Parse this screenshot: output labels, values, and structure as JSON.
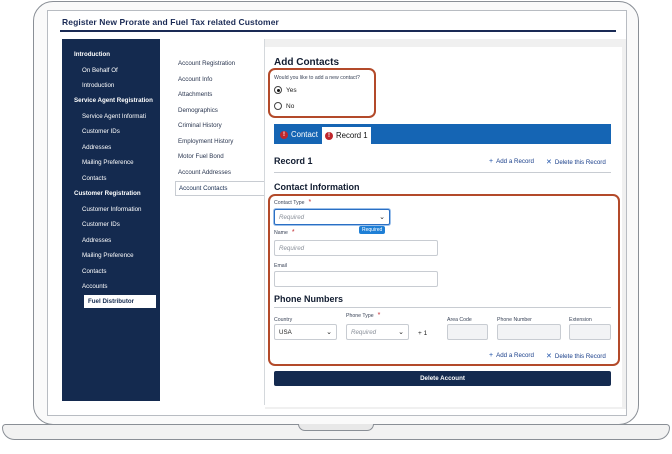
{
  "app": {
    "title": "Register New Prorate and Fuel Tax related Customer"
  },
  "leftnav": {
    "items": [
      {
        "label": "Introduction",
        "head": true
      },
      {
        "label": "On Behalf Of",
        "head": false
      },
      {
        "label": "Introduction",
        "head": false
      },
      {
        "label": "Service Agent Registration",
        "head": true
      },
      {
        "label": "Service Agent Informati",
        "head": false
      },
      {
        "label": "Customer IDs",
        "head": false
      },
      {
        "label": "Addresses",
        "head": false
      },
      {
        "label": "Mailing Preference",
        "head": false
      },
      {
        "label": "Contacts",
        "head": false
      },
      {
        "label": "Customer Registration",
        "head": true
      },
      {
        "label": "Customer Information",
        "head": false
      },
      {
        "label": "Customer IDs",
        "head": false
      },
      {
        "label": "Addresses",
        "head": false
      },
      {
        "label": "Mailing Preference",
        "head": false
      },
      {
        "label": "Contacts",
        "head": false
      },
      {
        "label": "Accounts",
        "head": false
      },
      {
        "label": "Fuel Distributor",
        "head": false,
        "active": true
      }
    ]
  },
  "midnav": {
    "items": [
      "Account Registration",
      "Account Info",
      "Attachments",
      "Demographics",
      "Criminal History",
      "Employment History",
      "Motor Fuel Bond",
      "Account Addresses",
      "Account Contacts"
    ],
    "active_index": 8
  },
  "add_contacts": {
    "heading": "Add Contacts",
    "question": "Would you like to add a new contact?",
    "yes": "Yes",
    "no": "No",
    "selected": "Yes"
  },
  "tabs": {
    "contact": "Contact",
    "record": "Record 1",
    "badge": "!"
  },
  "record": {
    "title": "Record 1",
    "add_label": "Add a Record",
    "delete_label": "Delete this Record"
  },
  "contact_info": {
    "heading": "Contact Information",
    "contact_type_label": "Contact Type",
    "contact_type_placeholder": "Required",
    "tooltip": "Required",
    "name_label": "Name",
    "name_placeholder": "Required",
    "email_label": "Email",
    "required_mark": "*"
  },
  "phone": {
    "heading": "Phone Numbers",
    "country_label": "Country",
    "country_value": "USA",
    "phone_type_label": "Phone Type",
    "phone_type_placeholder": "Required",
    "country_code": "+ 1",
    "area_code_label": "Area Code",
    "phone_number_label": "Phone Number",
    "extension_label": "Extension",
    "add_label": "Add a Record",
    "delete_label": "Delete this Record"
  },
  "actions": {
    "delete_account": "Delete Account"
  },
  "colors": {
    "nav_bg": "#142a4f",
    "tab_blue": "#1565b4",
    "highlight": "#b34a2a",
    "error_red": "#c0272d"
  }
}
